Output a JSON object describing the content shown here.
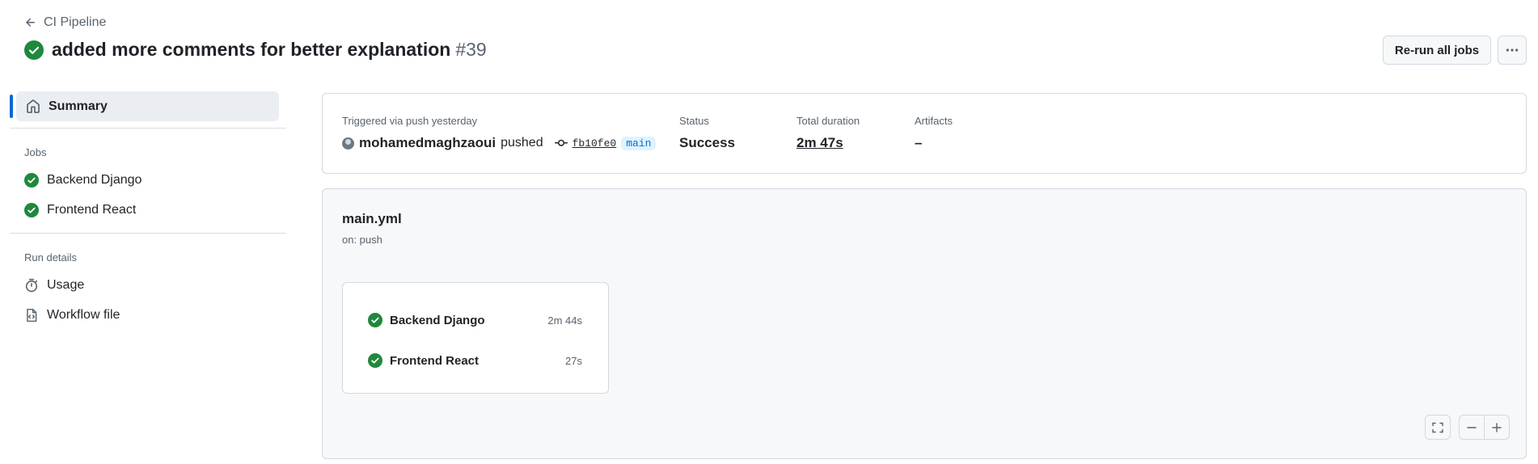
{
  "header": {
    "back_label": "CI Pipeline",
    "title": "added more comments for better explanation",
    "run_number": "#39",
    "rerun_label": "Re-run all jobs"
  },
  "sidebar": {
    "summary_label": "Summary",
    "jobs_section": "Jobs",
    "jobs": [
      {
        "label": "Backend Django"
      },
      {
        "label": "Frontend React"
      }
    ],
    "run_details_section": "Run details",
    "usage_label": "Usage",
    "workflow_file_label": "Workflow file"
  },
  "summary": {
    "triggered_label": "Triggered via push yesterday",
    "actor": "mohamedmaghzaoui",
    "action": "pushed",
    "commit_sha": "fb10fe0",
    "branch": "main",
    "status_label": "Status",
    "status_value": "Success",
    "duration_label": "Total duration",
    "duration_value": "2m 47s",
    "artifacts_label": "Artifacts",
    "artifacts_value": "–"
  },
  "graph": {
    "workflow_name": "main.yml",
    "trigger": "on: push",
    "jobs": [
      {
        "name": "Backend Django",
        "duration": "2m 44s"
      },
      {
        "name": "Frontend React",
        "duration": "27s"
      }
    ]
  },
  "colors": {
    "success": "#1f883d",
    "accent": "#0969da"
  }
}
